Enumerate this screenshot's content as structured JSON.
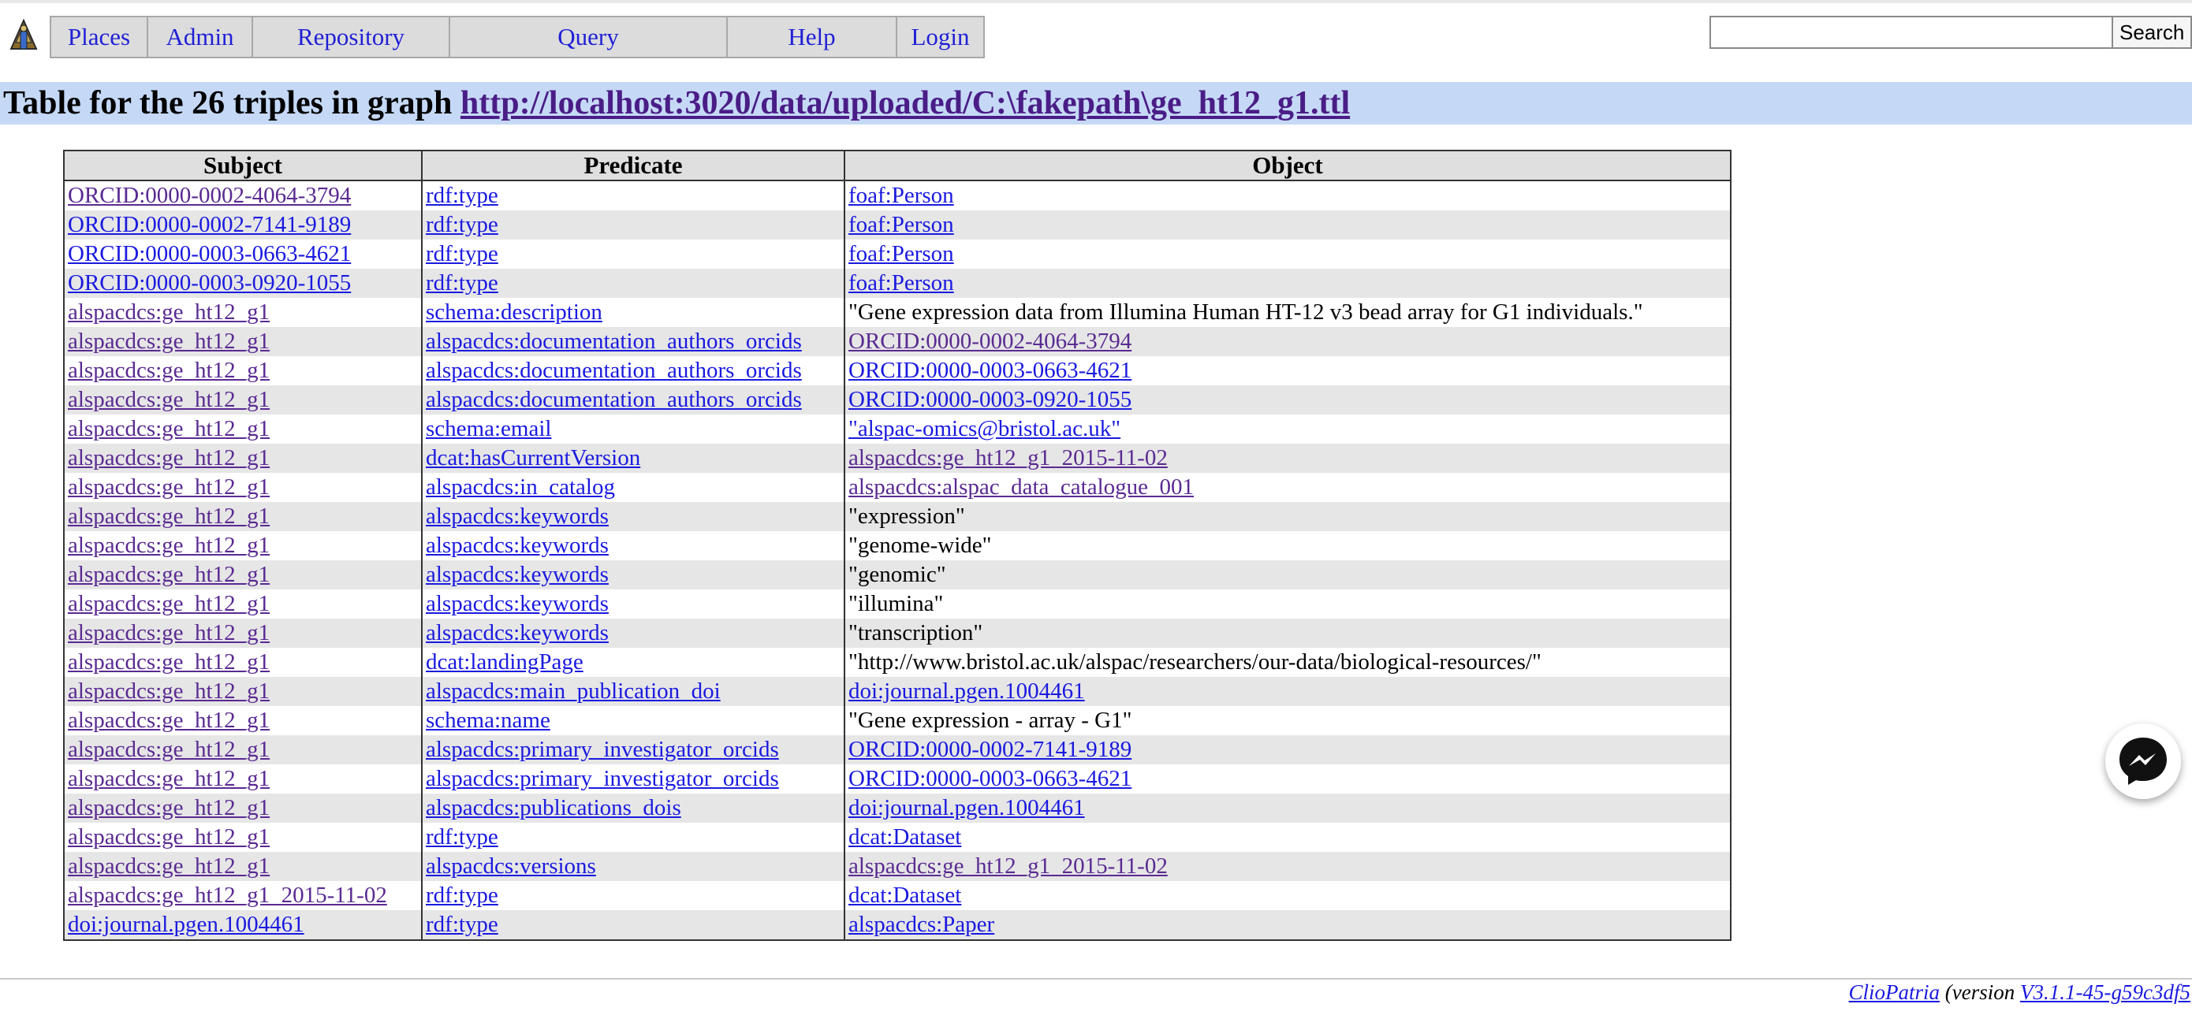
{
  "menu": {
    "items": [
      {
        "id": "places",
        "label": "Places"
      },
      {
        "id": "admin",
        "label": "Admin"
      },
      {
        "id": "repository",
        "label": "Repository"
      },
      {
        "id": "query",
        "label": "Query"
      },
      {
        "id": "help",
        "label": "Help"
      },
      {
        "id": "login",
        "label": "Login"
      }
    ]
  },
  "search": {
    "value": "",
    "button_label": "Search"
  },
  "heading": {
    "prefix": "Table for the 26 triples in graph ",
    "graph_link": "http://localhost:3020/data/uploaded/C:\\fakepath\\ge_ht12_g1.ttl"
  },
  "table": {
    "headers": [
      "Subject",
      "Predicate",
      "Object"
    ],
    "rows": [
      {
        "s": "ORCID:0000-0002-4064-3794",
        "s_visited": true,
        "p": "rdf:type",
        "o": "foaf:Person",
        "o_link": true
      },
      {
        "s": "ORCID:0000-0002-7141-9189",
        "p": "rdf:type",
        "o": "foaf:Person",
        "o_link": true
      },
      {
        "s": "ORCID:0000-0003-0663-4621",
        "p": "rdf:type",
        "o": "foaf:Person",
        "o_link": true
      },
      {
        "s": "ORCID:0000-0003-0920-1055",
        "p": "rdf:type",
        "o": "foaf:Person",
        "o_link": true
      },
      {
        "s": "alspacdcs:ge_ht12_g1",
        "s_visited": true,
        "p": "schema:description",
        "o": "\"Gene expression data from Illumina Human HT-12 v3 bead array for G1 individuals.\"",
        "o_link": false
      },
      {
        "s": "alspacdcs:ge_ht12_g1",
        "s_visited": true,
        "p": "alspacdcs:documentation_authors_orcids",
        "o": "ORCID:0000-0002-4064-3794",
        "o_link": true,
        "o_visited": true
      },
      {
        "s": "alspacdcs:ge_ht12_g1",
        "s_visited": true,
        "p": "alspacdcs:documentation_authors_orcids",
        "o": "ORCID:0000-0003-0663-4621",
        "o_link": true
      },
      {
        "s": "alspacdcs:ge_ht12_g1",
        "s_visited": true,
        "p": "alspacdcs:documentation_authors_orcids",
        "o": "ORCID:0000-0003-0920-1055",
        "o_link": true
      },
      {
        "s": "alspacdcs:ge_ht12_g1",
        "s_visited": true,
        "p": "schema:email",
        "o": "\"alspac-omics@bristol.ac.uk\"",
        "o_link": true
      },
      {
        "s": "alspacdcs:ge_ht12_g1",
        "s_visited": true,
        "p": "dcat:hasCurrentVersion",
        "o": "alspacdcs:ge_ht12_g1_2015-11-02",
        "o_link": true,
        "o_visited": true
      },
      {
        "s": "alspacdcs:ge_ht12_g1",
        "s_visited": true,
        "p": "alspacdcs:in_catalog",
        "o": "alspacdcs:alspac_data_catalogue_001",
        "o_link": true,
        "o_visited": true
      },
      {
        "s": "alspacdcs:ge_ht12_g1",
        "s_visited": true,
        "p": "alspacdcs:keywords",
        "o": "\"expression\"",
        "o_link": false
      },
      {
        "s": "alspacdcs:ge_ht12_g1",
        "s_visited": true,
        "p": "alspacdcs:keywords",
        "o": "\"genome-wide\"",
        "o_link": false
      },
      {
        "s": "alspacdcs:ge_ht12_g1",
        "s_visited": true,
        "p": "alspacdcs:keywords",
        "o": "\"genomic\"",
        "o_link": false
      },
      {
        "s": "alspacdcs:ge_ht12_g1",
        "s_visited": true,
        "p": "alspacdcs:keywords",
        "o": "\"illumina\"",
        "o_link": false
      },
      {
        "s": "alspacdcs:ge_ht12_g1",
        "s_visited": true,
        "p": "alspacdcs:keywords",
        "o": "\"transcription\"",
        "o_link": false
      },
      {
        "s": "alspacdcs:ge_ht12_g1",
        "s_visited": true,
        "p": "dcat:landingPage",
        "o": "\"http://www.bristol.ac.uk/alspac/researchers/our-data/biological-resources/\"",
        "o_link": false
      },
      {
        "s": "alspacdcs:ge_ht12_g1",
        "s_visited": true,
        "p": "alspacdcs:main_publication_doi",
        "o": "doi:journal.pgen.1004461",
        "o_link": true
      },
      {
        "s": "alspacdcs:ge_ht12_g1",
        "s_visited": true,
        "p": "schema:name",
        "o": "\"Gene expression - array - G1\"",
        "o_link": false
      },
      {
        "s": "alspacdcs:ge_ht12_g1",
        "s_visited": true,
        "p": "alspacdcs:primary_investigator_orcids",
        "o": "ORCID:0000-0002-7141-9189",
        "o_link": true
      },
      {
        "s": "alspacdcs:ge_ht12_g1",
        "s_visited": true,
        "p": "alspacdcs:primary_investigator_orcids",
        "o": "ORCID:0000-0003-0663-4621",
        "o_link": true
      },
      {
        "s": "alspacdcs:ge_ht12_g1",
        "s_visited": true,
        "p": "alspacdcs:publications_dois",
        "o": "doi:journal.pgen.1004461",
        "o_link": true
      },
      {
        "s": "alspacdcs:ge_ht12_g1",
        "s_visited": true,
        "p": "rdf:type",
        "o": "dcat:Dataset",
        "o_link": true
      },
      {
        "s": "alspacdcs:ge_ht12_g1",
        "s_visited": true,
        "p": "alspacdcs:versions",
        "o": "alspacdcs:ge_ht12_g1_2015-11-02",
        "o_link": true,
        "o_visited": true
      },
      {
        "s": "alspacdcs:ge_ht12_g1_2015-11-02",
        "s_visited": true,
        "p": "rdf:type",
        "o": "dcat:Dataset",
        "o_link": true
      },
      {
        "s": "doi:journal.pgen.1004461",
        "p": "rdf:type",
        "o": "alspacdcs:Paper",
        "o_link": true
      }
    ]
  },
  "footer": {
    "app_link": "ClioPatria",
    "version_prefix": " (version ",
    "version_link": "V3.1.1-45-g59c3df5"
  },
  "colors": {
    "link": "#1a1ae0",
    "visited_link": "#5a2a92",
    "heading_bg": "#c5d9f7",
    "row_stripe": "#e6e6e6",
    "menu_bg": "#dcdcdc"
  },
  "icons": {
    "logo": "cliopatria-logo-icon",
    "messenger": "messenger-chat-icon"
  }
}
